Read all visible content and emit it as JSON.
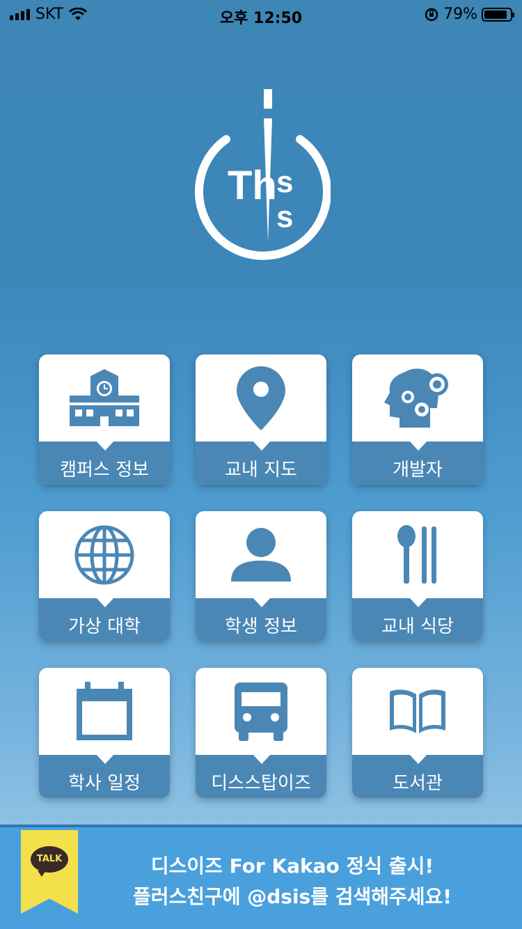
{
  "status_bar": {
    "carrier": "SKT",
    "time": "오후 12:50",
    "battery_percent": "79%",
    "icons": [
      "signal-icon",
      "wifi-icon",
      "orientation-lock-icon",
      "battery-icon"
    ]
  },
  "logo": {
    "text_left": "Th",
    "text_right_top": "s",
    "text_right_bottom": "s",
    "icon": "this-is-logo"
  },
  "menu": {
    "items": [
      {
        "label": "캠퍼스 정보",
        "icon": "school-building-icon"
      },
      {
        "label": "교내 지도",
        "icon": "map-pin-icon"
      },
      {
        "label": "개발자",
        "icon": "head-gears-icon"
      },
      {
        "label": "가상 대학",
        "icon": "globe-icon"
      },
      {
        "label": "학생 정보",
        "icon": "person-icon"
      },
      {
        "label": "교내 식당",
        "icon": "spoon-chopsticks-icon"
      },
      {
        "label": "학사 일정",
        "icon": "calendar-icon"
      },
      {
        "label": "디스스탑이즈",
        "icon": "bus-icon"
      },
      {
        "label": "도서관",
        "icon": "open-book-icon"
      }
    ]
  },
  "banner": {
    "badge": "TALK",
    "line1": "디스이즈 For Kakao 정식 출시!",
    "line2": "플러스친구에 @dsis를 검색해주세요!",
    "colors": {
      "background": "#4aa0dd",
      "flag": "#f3e04b"
    }
  },
  "colors": {
    "accent": "#4a87b5",
    "tile": "#ffffff"
  }
}
